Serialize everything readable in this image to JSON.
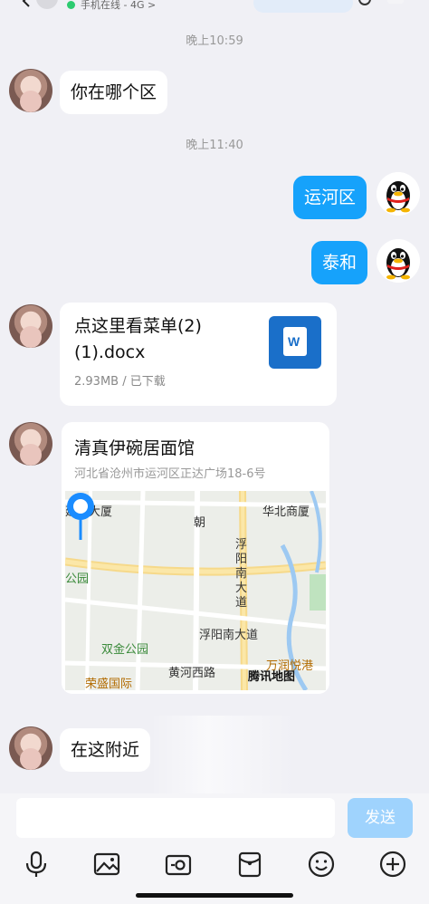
{
  "header": {
    "status_text": "手机在线 - 4G >"
  },
  "messages": {
    "time_1": "晚上10:59",
    "msg_1": "你在哪个区",
    "time_2": "晚上11:40",
    "msg_2": "运河区",
    "msg_3": "泰和",
    "file": {
      "name": "点这里看菜单(2)(1).docx",
      "meta": "2.93MB / 已下载",
      "icon_letter": "W"
    },
    "location": {
      "title": "清真伊碗居面馆",
      "address": "河北省沧州市运河区正达广场18-6号",
      "map_labels": {
        "l1": "建业大厦",
        "l2": "华北商厦",
        "l3": "朝",
        "l4": "浮阳南大道",
        "l5": "公园",
        "l6": "浮阳南大道",
        "l7": "双金公园",
        "l8": "黄河西路",
        "l9": "万润悦港",
        "l10": "荣盛国际"
      },
      "map_provider": "腾讯地图"
    },
    "msg_last": "在这附近"
  },
  "composer": {
    "input_value": "",
    "send_label": "发送"
  },
  "colors": {
    "background": "#f0f0f5",
    "outgoing_bubble": "#16a2fb",
    "send_button": "#9fd3fd",
    "online_dot": "#2dcb70"
  },
  "icons": [
    "back-arrow-icon",
    "microphone-icon",
    "image-icon",
    "camera-icon",
    "red-packet-icon",
    "emoji-icon",
    "plus-icon"
  ]
}
